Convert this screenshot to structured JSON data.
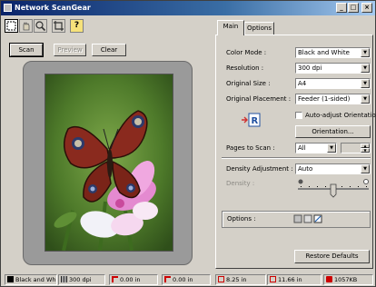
{
  "window": {
    "title": "Network ScanGear",
    "controls": {
      "minimize": "_",
      "maximize": "□",
      "close": "×"
    }
  },
  "toolbar": {
    "tools": [
      {
        "name": "select-tool",
        "glyph": "⬚"
      },
      {
        "name": "hand-tool",
        "glyph": "✋"
      },
      {
        "name": "zoom-tool",
        "glyph": "🔍"
      },
      {
        "name": "crop-tool",
        "glyph": "⌐"
      },
      {
        "name": "help-tool",
        "glyph": "?"
      }
    ]
  },
  "actions": {
    "scan": "Scan",
    "preview": "Preview",
    "clear": "Clear"
  },
  "tabs": [
    {
      "label": "Main"
    },
    {
      "label": "Options"
    }
  ],
  "settings": {
    "color_mode": {
      "label": "Color Mode :",
      "value": "Black and White"
    },
    "resolution": {
      "label": "Resolution :",
      "value": "300 dpi"
    },
    "original_size": {
      "label": "Original Size :",
      "value": "A4"
    },
    "original_placement": {
      "label": "Original Placement :",
      "value": "Feeder (1-sided)"
    },
    "auto_adjust": {
      "label": "Auto-adjust Orientation",
      "checked": false
    },
    "orientation_button": "Orientation...",
    "pages_to_scan": {
      "label": "Pages to Scan :",
      "value": "All"
    },
    "density_adjustment": {
      "label": "Density Adjustment :",
      "value": "Auto"
    },
    "density": {
      "label": "Density :",
      "level": 0.5
    },
    "options_label": "Options :",
    "restore_defaults": "Restore Defaults"
  },
  "status": {
    "color_mode": "Black and Wh",
    "resolution": "300 dpi",
    "x_offset": "0.00 in",
    "y_offset": "0.00 in",
    "width": "8.25 in",
    "height": "11.66 in",
    "file_size": "1057KB"
  },
  "colors": {
    "title_start": "#0a246a",
    "title_end": "#a6caf0",
    "face": "#d4d0c8",
    "preview_bg": "#9a9a9a"
  }
}
